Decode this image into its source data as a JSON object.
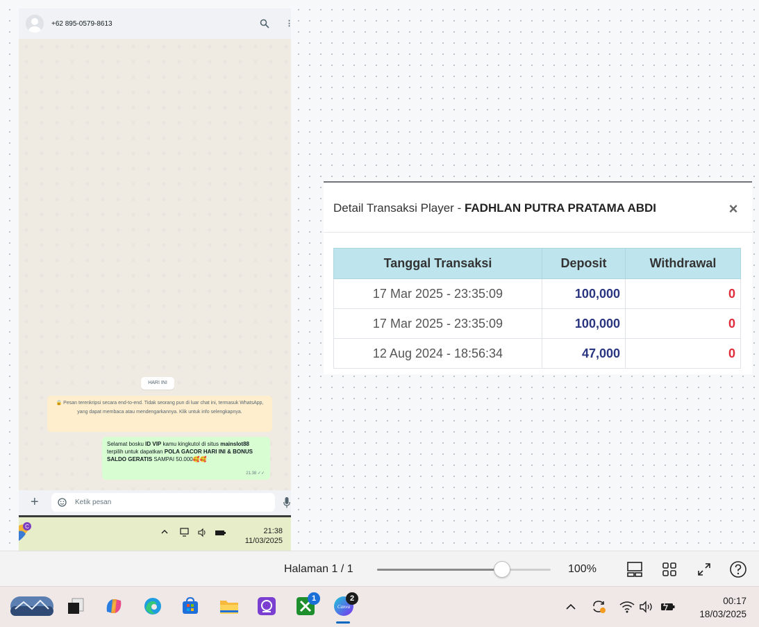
{
  "whatsapp": {
    "contact_phone": "+62 895-0579-8613",
    "date_chip": "HARI INI",
    "encryption_notice": "🔒 Pesan terenkripsi secara end-to-end. Tidak seorang pun di luar chat ini, termasuk WhatsApp, yang dapat membaca atau mendengarkannya. Klik untuk info selengkapnya.",
    "message": {
      "p1": "Selamat bosku ",
      "b1": "ID VIP",
      "p2": " kamu kingkutol di situs ",
      "b2": "mainslot88",
      "p3": " terpilih untuk dapatkan ",
      "b3": "POLA GACOR HARI INI & BONUS SALDO GERATIS",
      "p4": "  SAMPAI 50.000🥰🥰",
      "time": "21.38 ✓✓"
    },
    "input_placeholder": "Ketik pesan",
    "taskbar_time": "21:38",
    "taskbar_date": "11/03/2025",
    "taskbar_app_badge": "C"
  },
  "panel": {
    "title_prefix": "Detail Transaksi Player - ",
    "player_name": "FADHLAN PUTRA PRATAMA ABDI",
    "close_glyph": "×",
    "columns": [
      "Tanggal Transaksi",
      "Deposit",
      "Withdrawal"
    ],
    "rows": [
      {
        "date": "17 Mar 2025 - 23:35:09",
        "deposit": "100,000",
        "withdrawal": "0"
      },
      {
        "date": "17 Mar 2025 - 23:35:09",
        "deposit": "100,000",
        "withdrawal": "0"
      },
      {
        "date": "12 Aug 2024 - 18:56:34",
        "deposit": "47,000",
        "withdrawal": "0"
      }
    ]
  },
  "viewer": {
    "page_label": "Halaman 1 / 1",
    "zoom_label": "100%",
    "zoom_fraction": 0.72,
    "buttons": [
      "page-layout-icon",
      "grid-view-icon",
      "fullscreen-icon",
      "help-icon"
    ]
  },
  "taskbar": {
    "apps": [
      "photo-app-icon",
      "task-view-icon",
      "copilot-icon",
      "edge-icon",
      "store-icon",
      "file-explorer-icon",
      "proton-vpn-icon",
      "xbox-icon",
      "canva-icon"
    ],
    "xbox_badge": "1",
    "canva_badge": "2",
    "canva_label": "Canva",
    "time": "00:17",
    "date": "18/03/2025"
  },
  "colors": {
    "table_header": "#bee5ed",
    "deposit": "#2a3580",
    "withdrawal": "#e02b3a",
    "wa_message": "#d9fdd3",
    "wa_notice": "#ffeecd"
  }
}
